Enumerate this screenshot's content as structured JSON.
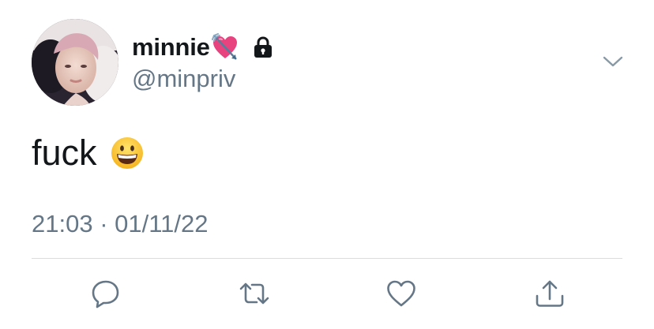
{
  "tweet": {
    "display_name": "minnie",
    "handle": "@minpriv",
    "text": "fuck",
    "timestamp": "21:03 · 01/11/22",
    "protected": true
  },
  "icons": {
    "name_emoji": "heart-with-arrow-icon",
    "protected": "lock-icon",
    "text_emoji": "grinning-face-icon",
    "menu": "chevron-down-icon",
    "actions": [
      "reply-icon",
      "retweet-icon",
      "like-icon",
      "share-icon"
    ]
  },
  "colors": {
    "text_primary": "#14171a",
    "text_secondary": "#657786",
    "divider": "#d8dde1",
    "icon": "#657786"
  }
}
